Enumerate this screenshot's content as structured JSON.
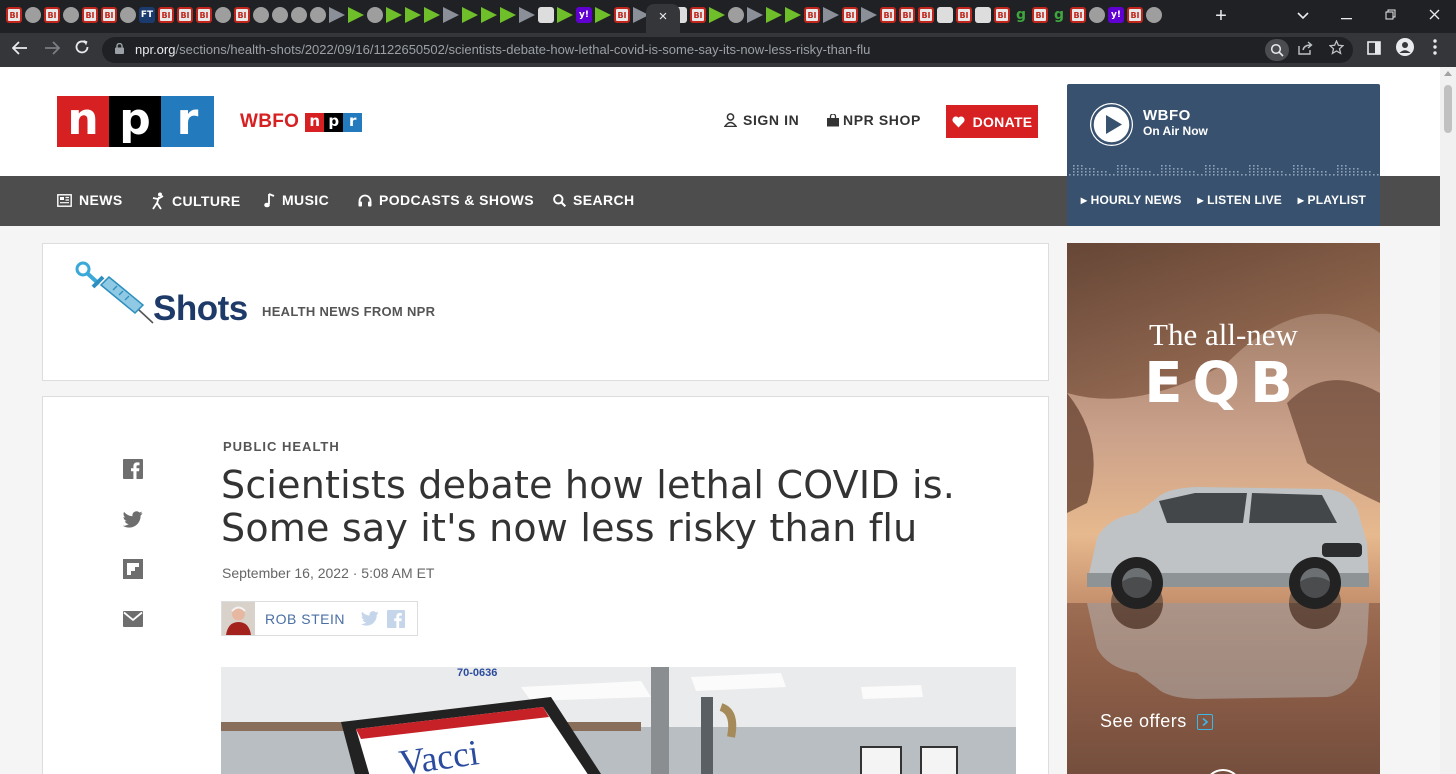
{
  "browser": {
    "tab_favicons": [
      "bi",
      "gl",
      "bi",
      "gl",
      "bi",
      "bi",
      "gl",
      "ft",
      "bi",
      "bi",
      "bi",
      "gl",
      "bi",
      "gl",
      "gl",
      "gl",
      "gl",
      "gr",
      "pl",
      "gl",
      "pl",
      "pl",
      "pl",
      "gr",
      "pl",
      "pl",
      "pl",
      "gr",
      "wh",
      "pl",
      "yh",
      "pl",
      "bi",
      "gr",
      "pl",
      "wh",
      "bi",
      "pl",
      "gl",
      "gr",
      "pl",
      "pl",
      "bi",
      "gr",
      "bi",
      "gr",
      "bi",
      "bi",
      "bi",
      "wh",
      "bi",
      "wh",
      "bi",
      "g9",
      "bi",
      "g9",
      "bi",
      "gl",
      "yh",
      "bi",
      "gl"
    ],
    "active_tab_close": "×",
    "new_tab": "+",
    "url_host": "npr.org",
    "url_path": "/sections/health-shots/2022/09/16/1122650502/scientists-debate-how-lethal-covid-is-some-say-its-now-less-risky-than-flu"
  },
  "header": {
    "logo": {
      "n": "n",
      "p": "p",
      "r": "r"
    },
    "station_call": "WBFO",
    "station_npr": {
      "n": "n",
      "p": "p",
      "r": "r"
    },
    "sign_in": "SIGN IN",
    "shop": "NPR SHOP",
    "donate": "DONATE"
  },
  "player": {
    "station": "WBFO",
    "status": "On Air Now",
    "links": [
      "HOURLY NEWS",
      "LISTEN LIVE",
      "PLAYLIST"
    ]
  },
  "nav": {
    "items": [
      "NEWS",
      "CULTURE",
      "MUSIC",
      "PODCASTS & SHOWS",
      "SEARCH"
    ]
  },
  "blog": {
    "name": "Shots",
    "tagline": "HEALTH NEWS FROM NPR"
  },
  "story": {
    "kicker": "PUBLIC HEALTH",
    "headline": "Scientists debate how lethal COVID is. Some say it's now less risky than flu",
    "dateline": "September 16, 2022 · 5:08 AM ET",
    "author": "ROB STEIN",
    "image_sign_text": "Vacci",
    "image_sign_number": "70-0636"
  },
  "ad": {
    "line1": "The all-new",
    "line2": "EQB",
    "cta": "See offers"
  },
  "colors": {
    "npr_red": "#d62021",
    "npr_blue": "#237bbd",
    "nav_bg": "#4d4d4d",
    "player_bg": "#37516e",
    "shots_navy": "#1e3a69",
    "byline_blue": "#4a6fa5"
  }
}
